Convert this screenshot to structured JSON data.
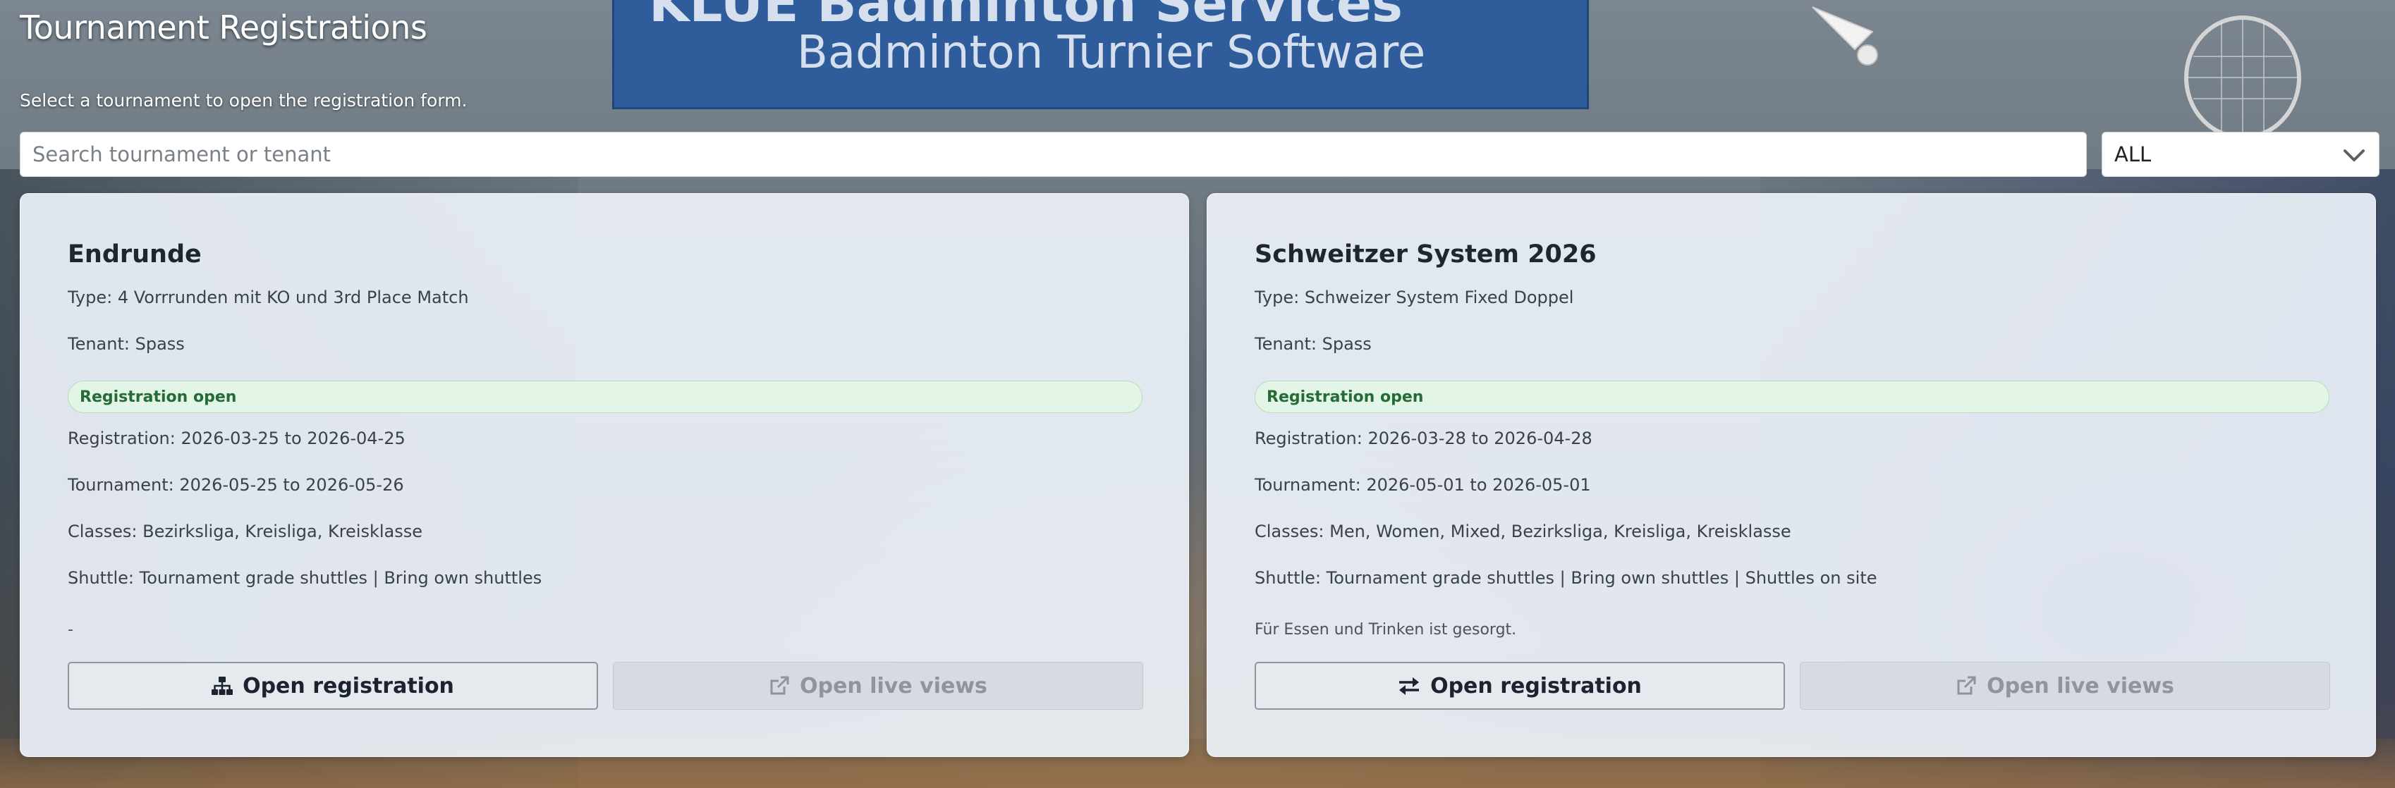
{
  "page": {
    "title": "Tournament Registrations",
    "subtitle": "Select a tournament to open the registration form."
  },
  "background": {
    "banner_line1": "KLUE Badminton Services",
    "banner_line2": "Badminton Turnier Software"
  },
  "filters": {
    "search_placeholder": "Search tournament or tenant",
    "search_value": "",
    "tenant_select_value": "ALL"
  },
  "tournaments": [
    {
      "name": "Endrunde",
      "type": "Type: 4 Vorrrunden mit KO und 3rd Place Match",
      "tenant": "Tenant: Spass",
      "status": "Registration open",
      "registration": "Registration: 2026-03-25 to 2026-04-25",
      "tournament": "Tournament: 2026-05-25 to 2026-05-26",
      "classes": "Classes: Bezirksliga, Kreisliga, Kreisklasse",
      "shuttle": "Shuttle: Tournament grade shuttles | Bring own shuttles",
      "note": "-",
      "open_registration": "Open registration",
      "open_live_views": "Open live views",
      "registration_icon": "sitemap-icon"
    },
    {
      "name": "Schweitzer System 2026",
      "type": "Type: Schweizer System Fixed Doppel",
      "tenant": "Tenant: Spass",
      "status": "Registration open",
      "registration": "Registration: 2026-03-28 to 2026-04-28",
      "tournament": "Tournament: 2026-05-01 to 2026-05-01",
      "classes": "Classes: Men, Women, Mixed, Bezirksliga, Kreisliga, Kreisklasse",
      "shuttle": "Shuttle: Tournament grade shuttles | Bring own shuttles | Shuttles on site",
      "note": "Für Essen und Trinken ist gesorgt.",
      "open_registration": "Open registration",
      "open_live_views": "Open live views",
      "registration_icon": "exchange-icon"
    }
  ],
  "colors": {
    "badge_bg": "#e3f5e6",
    "badge_text": "#256b35",
    "card_bg": "#ecf1f9",
    "disabled_text": "#8e959e"
  }
}
